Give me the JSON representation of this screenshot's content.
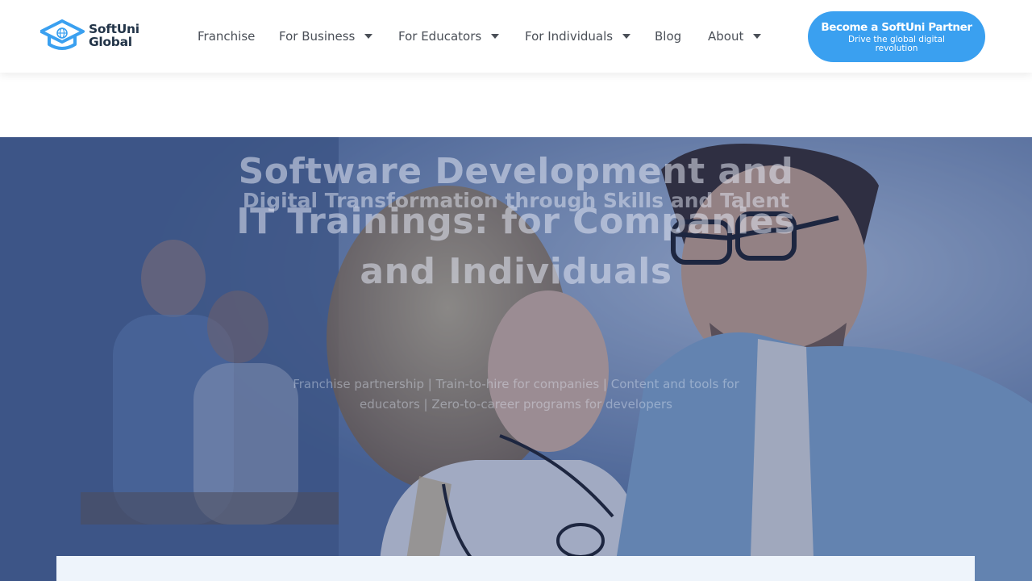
{
  "brand": {
    "logo_line1": "SoftUni",
    "logo_line2": "Global",
    "primary_color": "#3aa0f0",
    "text_color": "#223448"
  },
  "nav": {
    "franchise": "Franchise",
    "for_business": "For Business",
    "for_educators": "For Educators",
    "for_individuals": "For Individuals",
    "blog": "Blog",
    "about": "About"
  },
  "cta": {
    "title": "Become a SoftUni Partner",
    "subtitle": "Drive the global digital revolution"
  },
  "hero": {
    "title": "Software Development and IT Trainings: for Companies and Individuals",
    "subtitle": "Digital Transformation through Skills and Talent",
    "tagline": "Franchise partnership | Train-to-hire for companies | Content and tools for educators | Zero-to-career programs for developers",
    "overlay_color": "#1e346e"
  }
}
